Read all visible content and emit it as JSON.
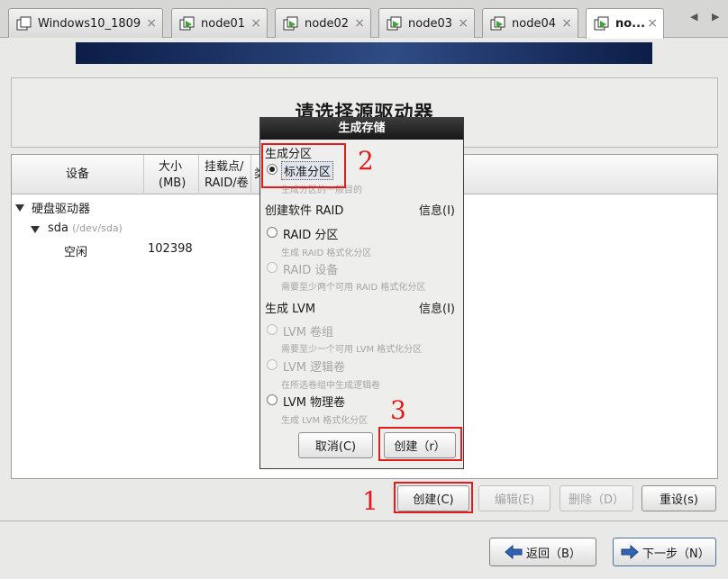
{
  "tabs": [
    {
      "label": "Windows10_1809",
      "active": false
    },
    {
      "label": "node01",
      "active": false
    },
    {
      "label": "node02",
      "active": false
    },
    {
      "label": "node03",
      "active": false
    },
    {
      "label": "node04",
      "active": false
    },
    {
      "label": "no...",
      "active": true
    }
  ],
  "tab_close_glyph": "×",
  "tab_scroll": {
    "left": "◀",
    "right": "▶"
  },
  "page_title": "请选择源驱动器",
  "table": {
    "columns": [
      "设备",
      "大小\n(MB)",
      "挂载点/\nRAID/卷",
      "类"
    ],
    "tree": {
      "group_label": "硬盘驱动器",
      "disk_name": "sda",
      "disk_path": "(/dev/sda)",
      "free_label": "空闲",
      "free_size": "102398"
    }
  },
  "dialog": {
    "title": "生成存储",
    "section_partition": "生成分区",
    "standard_partition": {
      "label": "标准分区",
      "desc": "生成分区的一般目的",
      "checked": true
    },
    "section_raid": "创建软件 RAID",
    "info_label": "信息(I)",
    "raid_partition": {
      "label": "RAID 分区",
      "desc": "生成 RAID 格式化分区"
    },
    "raid_device": {
      "label": "RAID 设备",
      "desc": "需要至少两个可用 RAID 格式化分区"
    },
    "section_lvm": "生成 LVM",
    "lvm_group": {
      "label": "LVM 卷组",
      "desc": "需要至少一个可用 LVM 格式化分区"
    },
    "lvm_logical": {
      "label": "LVM 逻辑卷",
      "desc": "在所选卷组中生成逻辑卷"
    },
    "lvm_physical": {
      "label": "LVM 物理卷",
      "desc": "生成 LVM 格式化分区"
    },
    "cancel_label": "取消(C)",
    "create_label": "创建（r）"
  },
  "actions": {
    "create": "创建(C)",
    "edit": "编辑(E)",
    "delete": "删除（D）",
    "reset": "重设(s)"
  },
  "nav": {
    "back": "返回（B）",
    "next": "下一步（N）"
  },
  "annotations": [
    "1",
    "2",
    "3"
  ],
  "colors": {
    "highlight": "#e21b1b",
    "banner": "#1a2c5c",
    "play_icon": "#3fa535"
  }
}
